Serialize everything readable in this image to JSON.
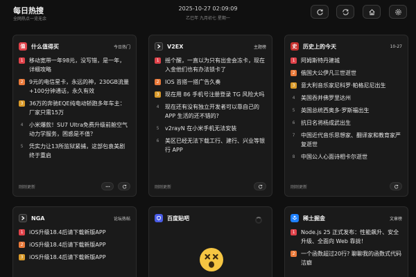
{
  "header": {
    "title": "每日热搜",
    "subtitle": "全网热点一览无余",
    "datetime": "2025-10-27 02:09:09",
    "lunar": "乙巳年 九月初七 星期一",
    "buttons": [
      {
        "icon": "refresh-icon"
      },
      {
        "icon": "sync-icon"
      },
      {
        "icon": "home-icon"
      },
      {
        "icon": "settings-icon"
      }
    ]
  },
  "cards": [
    {
      "title": "什么值得买",
      "tag": "今日热门",
      "logo": "值",
      "logo_color": "#e0424a",
      "footer": "刚刚更新",
      "items": [
        "移动宽带一年98元，没写错，是一年，详细攻略",
        "9元的电信星卡，永远的神，230GB流量+100分钟通话，永久有效",
        "36万的奔驰EQE纯电动轿跑多年车主：厂家只需15万",
        "小米爆款！SU7 Ultra免费升级前舱空气动力学服务，困惑是不值？",
        "凭实力让13所监狱紧捕，这部包袁美剧终于重启"
      ]
    },
    {
      "title": "V2EX",
      "tag": "主题榜",
      "logo": "V",
      "logo_color": "#3a3a3a",
      "footer": "刚刚更新",
      "items": [
        "摇个醒，一直以为只有出金会冻卡，现在入金他们也有办法锁卡了",
        "IOS 苔搭一搭广告久奏",
        "现在用 86 手机号注册登录 TG 风险大吗",
        "现在还有没有独立开发者可以靠自己的 APP 生活的还不错的?",
        "v2rayN 在小米手机无法安装",
        "美区已经无法下载工行、建行、兴业等银行 APP"
      ]
    },
    {
      "title": "历史上的今天",
      "tag": "10-27",
      "logo": "史",
      "logo_color": "#c8322f",
      "footer": "刚刚更新",
      "items": [
        "阿姆斯特丹建城",
        "俄国大公伊凡三世逝世",
        "意大利音乐家尼科罗·帕格尼尼出生",
        "美国吞并佛罗里达州",
        "英国总统西奥多·罗斯福出生",
        "抗日名将杨成武出生",
        "中国近代音乐思想家、翻译家和教育家严复逝世",
        "中国公人心面诗相卡尔逝世"
      ]
    },
    {
      "title": "NGA",
      "tag": "论坛热帖",
      "logo": "N",
      "logo_color": "#2b2b2b",
      "items": [
        "iOS升级18.4后请下载新版APP",
        "iOS升级18.4后请下载新版APP",
        "iOS升级18.4后请下载新版APP"
      ]
    },
    {
      "title": "百度贴吧",
      "tag": "",
      "logo": "贴",
      "logo_color": "#4a5ce6",
      "items": []
    },
    {
      "title": "稀土掘金",
      "tag": "文章榜",
      "logo": "掘",
      "logo_color": "#1e80ff",
      "items": [
        "Node.js 25 正式发布：性能飙升、安全升级、全面向 Web 靠拢！",
        "一个函数超过20行? 聊聊我的函数式代码洁癖"
      ]
    }
  ]
}
